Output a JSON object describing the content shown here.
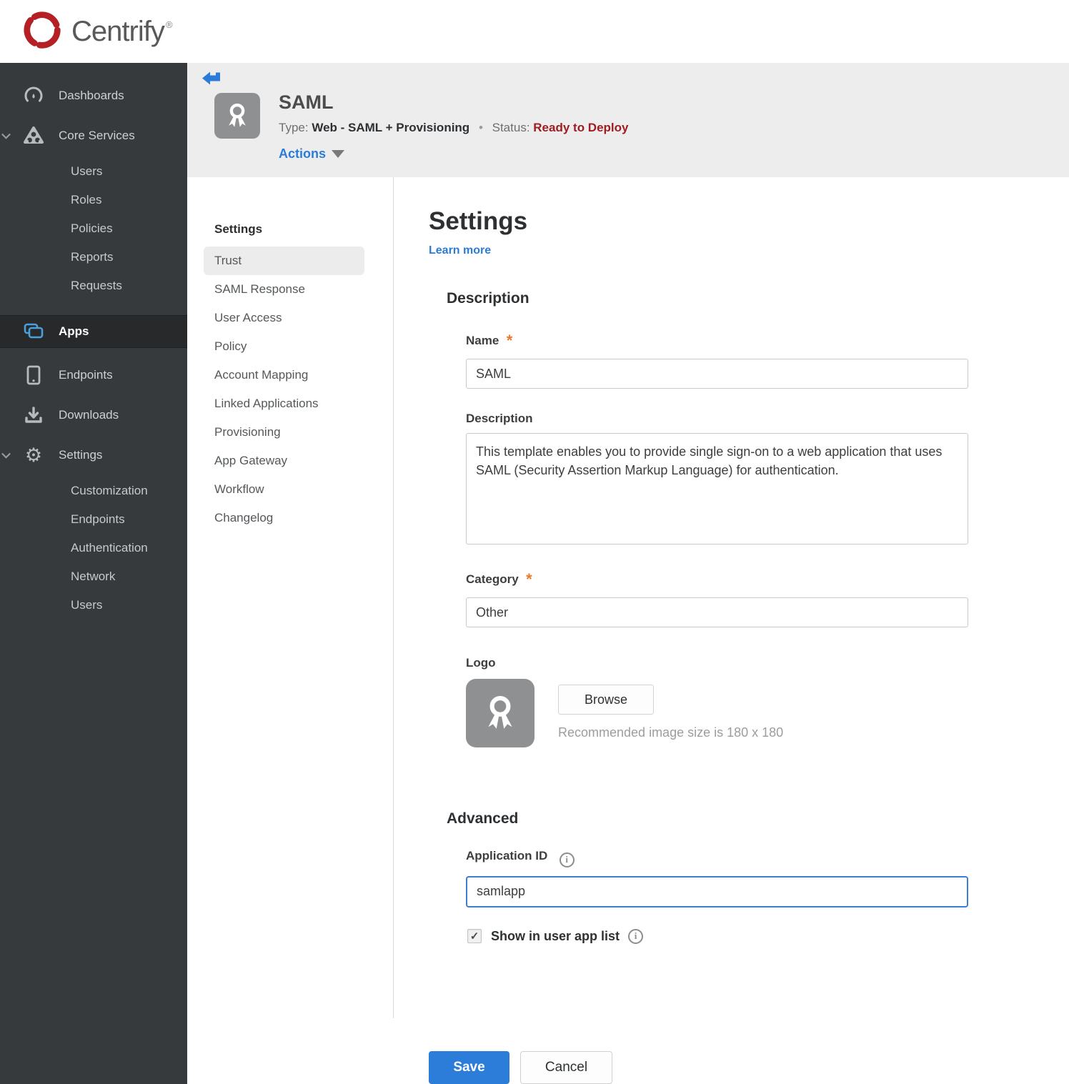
{
  "brand": {
    "name": "Centrify",
    "trademark": "®",
    "logo_color": "#b52025",
    "wordmark_color": "#58595b"
  },
  "sidebar": {
    "items": [
      {
        "label": "Dashboards",
        "icon": "gauge-icon"
      },
      {
        "label": "Core Services",
        "icon": "core-services-icon",
        "expanded": true,
        "children": [
          "Users",
          "Roles",
          "Policies",
          "Reports",
          "Requests"
        ]
      },
      {
        "label": "Apps",
        "icon": "apps-icon",
        "active": true
      },
      {
        "label": "Endpoints",
        "icon": "device-icon"
      },
      {
        "label": "Downloads",
        "icon": "download-icon"
      },
      {
        "label": "Settings",
        "icon": "gear-icon",
        "expanded": true,
        "children": [
          "Customization",
          "Endpoints",
          "Authentication",
          "Network",
          "Users"
        ]
      }
    ]
  },
  "app_header": {
    "title": "SAML",
    "type_label": "Type:",
    "type_value": "Web - SAML + Provisioning",
    "separator": "•",
    "status_label": "Status:",
    "status_value": "Ready to Deploy",
    "actions_label": "Actions"
  },
  "subnav": {
    "header": "Settings",
    "active": "Trust",
    "items": [
      "Trust",
      "SAML Response",
      "User Access",
      "Policy",
      "Account Mapping",
      "Linked Applications",
      "Provisioning",
      "App Gateway",
      "Workflow",
      "Changelog"
    ]
  },
  "form": {
    "title": "Settings",
    "learn_more": "Learn more",
    "description_section": "Description",
    "required_marker": "*",
    "name_label": "Name",
    "name_value": "SAML",
    "description_label": "Description",
    "description_value": "This template enables you to provide single sign-on to a web application that uses SAML (Security Assertion Markup Language) for authentication.",
    "category_label": "Category",
    "category_value": "Other",
    "logo_label": "Logo",
    "browse_label": "Browse",
    "logo_hint": "Recommended image size is 180 x 180",
    "advanced_section": "Advanced",
    "app_id_label": "Application ID",
    "app_id_value": "samlapp",
    "show_in_list_label": "Show in user app list",
    "show_in_list_checked": "checked",
    "save_label": "Save",
    "cancel_label": "Cancel"
  },
  "icons": {
    "check_glyph": "✓",
    "gear_glyph": "⚙",
    "info_glyph": "i"
  },
  "colors": {
    "accent_blue": "#2b7cd9",
    "focus_border_blue": "#3a7fd5",
    "status_red": "#9e1d20",
    "required_orange": "#e87a2a",
    "sidebar_bg": "#363a3c",
    "sidebar_active_bg": "#27292b",
    "apps_icon_blue": "#4ba0dc",
    "header_band_gray": "#ededee",
    "logo_tile_gray": "#8f9092"
  }
}
